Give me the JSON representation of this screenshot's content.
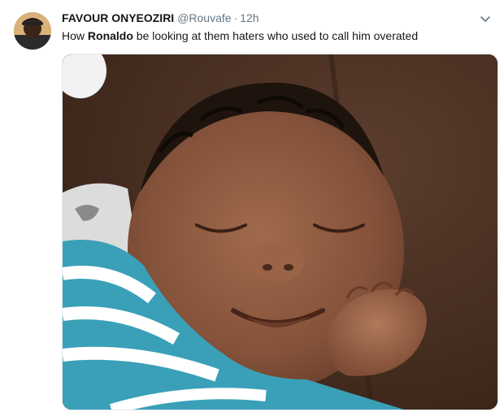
{
  "tweet": {
    "author": {
      "name": "FAVOUR ONYEOZIRI",
      "handle": "@Rouvafe"
    },
    "separator": "·",
    "timestamp": "12h",
    "text_pre": "How ",
    "text_bold": "Ronaldo",
    "text_post": " be looking at them haters who used to call him overated",
    "menu_icon": "chevron-down-icon",
    "colors": {
      "name": "#14171a",
      "meta": "#657786",
      "border": "#e1e8ed"
    }
  }
}
